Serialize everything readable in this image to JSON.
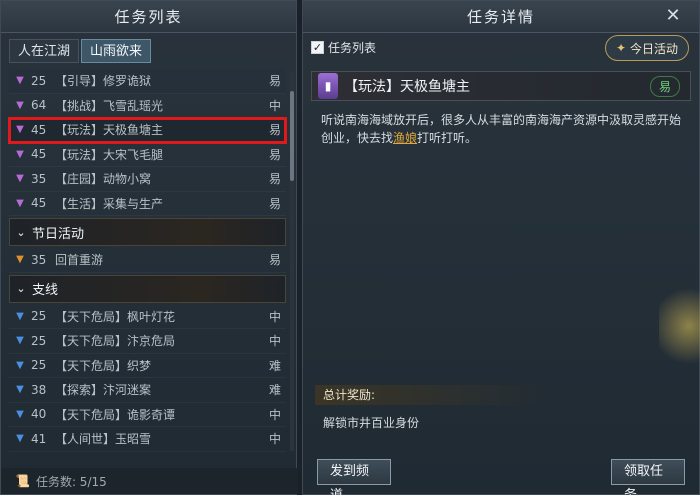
{
  "left_panel": {
    "title": "任务列表",
    "tabs": [
      "人在江湖",
      "山雨欲来"
    ],
    "active_tab_index": 1,
    "tasks_top": [
      {
        "arrow": "▼",
        "arrow_color": "#b86bd6",
        "level": "25",
        "name": "【引导】修罗诡狱",
        "difficulty": "易"
      },
      {
        "arrow": "▼",
        "arrow_color": "#b86bd6",
        "level": "64",
        "name": "【挑战】飞雪乱瑶光",
        "difficulty": "中"
      },
      {
        "arrow": "▼",
        "arrow_color": "#b86bd6",
        "level": "45",
        "name": "【玩法】天极鱼塘主",
        "difficulty": "易"
      },
      {
        "arrow": "▼",
        "arrow_color": "#b86bd6",
        "level": "45",
        "name": "【玩法】大宋飞毛腿",
        "difficulty": "易"
      },
      {
        "arrow": "▼",
        "arrow_color": "#b86bd6",
        "level": "35",
        "name": "【庄园】动物小窝",
        "difficulty": "易"
      },
      {
        "arrow": "▼",
        "arrow_color": "#b86bd6",
        "level": "45",
        "name": "【生活】采集与生产",
        "difficulty": "易"
      }
    ],
    "section_festival": "节日活动",
    "tasks_festival": [
      {
        "arrow": "▼",
        "arrow_color": "#e0902c",
        "level": "35",
        "name": "回首重游",
        "difficulty": "易"
      }
    ],
    "section_branch": "支线",
    "tasks_branch": [
      {
        "arrow": "▼",
        "arrow_color": "#4a8fe0",
        "level": "25",
        "name": "【天下危局】枫叶灯花",
        "difficulty": "中"
      },
      {
        "arrow": "▼",
        "arrow_color": "#4a8fe0",
        "level": "25",
        "name": "【天下危局】汴京危局",
        "difficulty": "中"
      },
      {
        "arrow": "▼",
        "arrow_color": "#4a8fe0",
        "level": "25",
        "name": "【天下危局】织梦",
        "difficulty": "难"
      },
      {
        "arrow": "▼",
        "arrow_color": "#4a8fe0",
        "level": "38",
        "name": "【探索】汴河迷案",
        "difficulty": "难"
      },
      {
        "arrow": "▼",
        "arrow_color": "#4a8fe0",
        "level": "40",
        "name": "【天下危局】诡影奇谭",
        "difficulty": "中"
      },
      {
        "arrow": "▼",
        "arrow_color": "#4a8fe0",
        "level": "41",
        "name": "【人间世】玉昭雪",
        "difficulty": "中"
      }
    ],
    "task_count_label": "任务数: 5/15"
  },
  "right_panel": {
    "title": "任务详情",
    "checkbox_label": "任务列表",
    "checkbox_checked": true,
    "daily_button": "今日活动",
    "quest_title": "【玩法】天极鱼塘主",
    "quest_difficulty": "易",
    "desc_before": "听说南海海域放开后，很多人从丰富的南海海产资源中汲取灵感开始创业，快去找",
    "desc_link": "渔娘",
    "desc_after": "打听打听。",
    "reward_label": "总计奖励:",
    "reward_text": "解锁市井百业身份",
    "send_button": "发到频道",
    "accept_button": "领取任务"
  }
}
